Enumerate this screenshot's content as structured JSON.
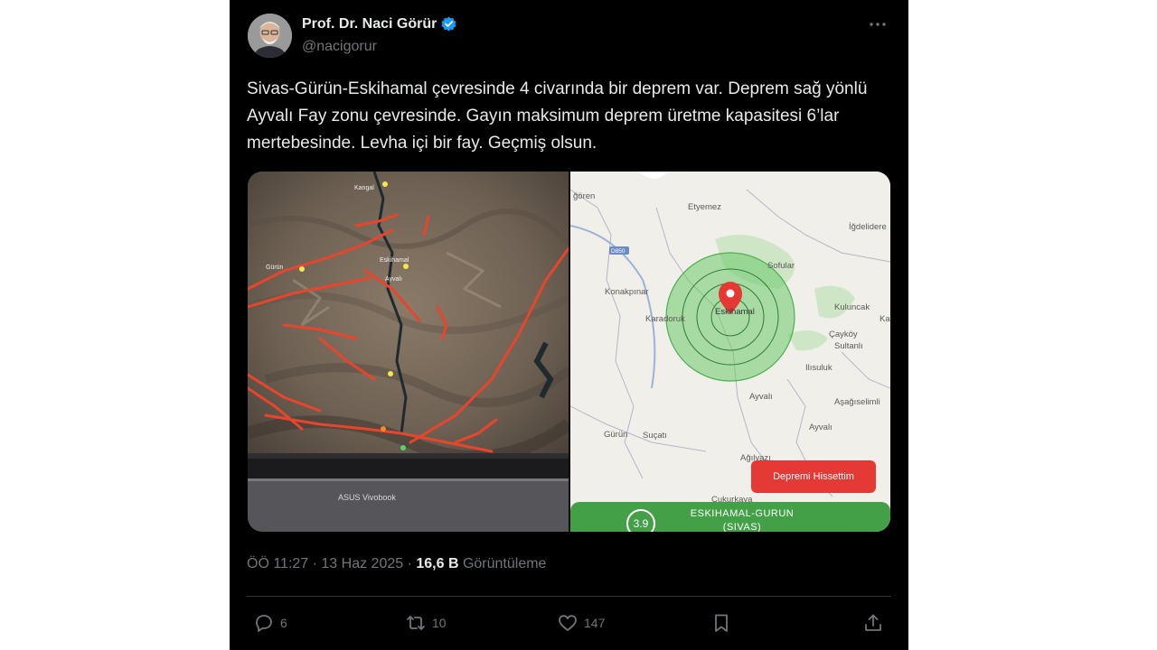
{
  "author": {
    "name": "Prof. Dr. Naci Görür",
    "handle": "@nacigorur"
  },
  "tweet": {
    "text": "Sivas-Gürün-Eskihamal çevresinde 4 civarında bir deprem var. Deprem sağ yönlü Ayvalı Fay zonu çevresinde. Gayın maksimum deprem üretme kapasitesi 6’lar mertebesinde. Levha içi bir fay. Geçmiş olsun."
  },
  "media": {
    "laptop_brand": "ASUS Vivobook",
    "map_labels": {
      "etyemez": "Etyemez",
      "igdeli": "İğdelidere",
      "soren": "ğören",
      "road": "D850",
      "sofular": "Sofular",
      "konakpinar": "Konakpınar",
      "karadoruk": "Karadoruk",
      "eskihamal": "Eskihamal",
      "kuluncak": "Kuluncak",
      "caykoy": "Çayköy",
      "sultanli": "Sultanlı",
      "ilisuluk": "Ilısuluk",
      "ayvali1": "Ayvalı",
      "asagiselimli": "Aşağıselimli",
      "ayvali2": "Ayvalı",
      "gurun": "Gürün",
      "sucati": "Suçatı",
      "agilyazi": "Ağılyazı",
      "cukurkaya": "Çukurkaya",
      "kar": "Ka"
    },
    "feel_button": "Depremi Hissettim",
    "magnitude": "3.9",
    "location_line1": "ESKIHAMAL-GURUN",
    "location_line2": "(SIVAS)"
  },
  "meta": {
    "time": "ÖÖ 11:27 · 13 Haz 2025 · ",
    "views": "16,6 B",
    "views_label": " Görüntüleme"
  },
  "actions": {
    "replies": "6",
    "reposts": "10",
    "likes": "147"
  },
  "colors": {
    "accent": "#1d9bf0",
    "fault": "#e8452c",
    "quake_green": "#43a047",
    "button_red": "#e53935"
  }
}
